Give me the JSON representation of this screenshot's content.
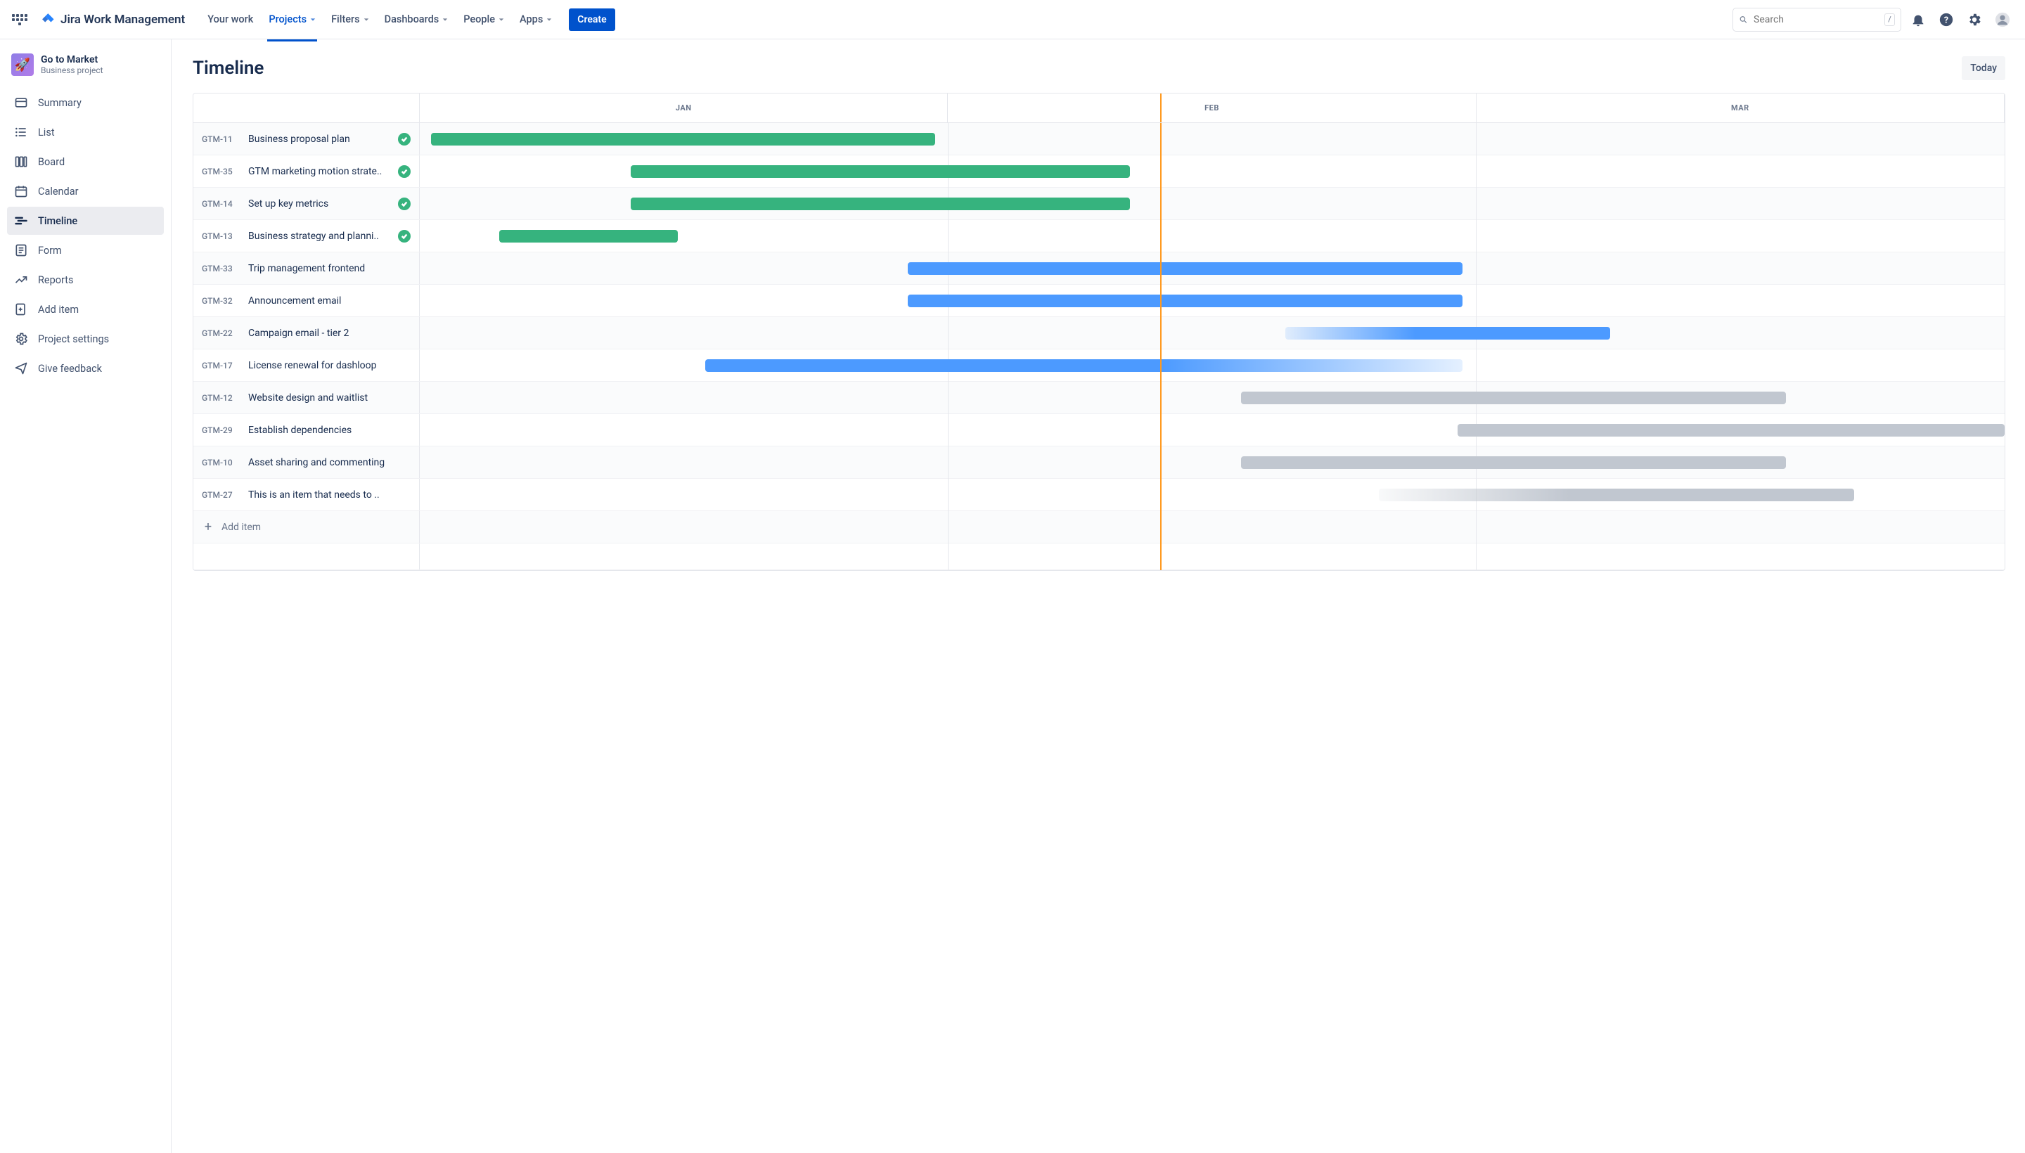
{
  "brand": "Jira Work Management",
  "nav": {
    "your_work": "Your work",
    "projects": "Projects",
    "filters": "Filters",
    "dashboards": "Dashboards",
    "people": "People",
    "apps": "Apps",
    "create": "Create"
  },
  "search": {
    "placeholder": "Search",
    "shortcut": "/"
  },
  "project": {
    "name": "Go to Market",
    "type": "Business project"
  },
  "sidebar": {
    "items": [
      {
        "id": "summary",
        "label": "Summary"
      },
      {
        "id": "list",
        "label": "List"
      },
      {
        "id": "board",
        "label": "Board"
      },
      {
        "id": "calendar",
        "label": "Calendar"
      },
      {
        "id": "timeline",
        "label": "Timeline",
        "active": true
      },
      {
        "id": "form",
        "label": "Form"
      },
      {
        "id": "reports",
        "label": "Reports"
      },
      {
        "id": "add-item",
        "label": "Add item"
      },
      {
        "id": "project-settings",
        "label": "Project settings"
      },
      {
        "id": "give-feedback",
        "label": "Give feedback"
      }
    ]
  },
  "page": {
    "title": "Timeline",
    "today": "Today"
  },
  "timeline": {
    "months": [
      "JAN",
      "FEB",
      "MAR"
    ],
    "today_pct": 46.7,
    "add_item": "Add item",
    "rows": [
      {
        "key": "GTM-11",
        "summary": "Business proposal plan",
        "done": true,
        "bar": {
          "left": 0.7,
          "width": 31.8,
          "style": "green"
        }
      },
      {
        "key": "GTM-35",
        "summary": "GTM marketing motion strate..",
        "done": true,
        "bar": {
          "left": 13.3,
          "width": 31.5,
          "style": "green"
        }
      },
      {
        "key": "GTM-14",
        "summary": "Set up key metrics",
        "done": true,
        "bar": {
          "left": 13.3,
          "width": 31.5,
          "style": "green"
        }
      },
      {
        "key": "GTM-13",
        "summary": "Business strategy and planni..",
        "done": true,
        "bar": {
          "left": 5.0,
          "width": 11.3,
          "style": "green"
        }
      },
      {
        "key": "GTM-33",
        "summary": "Trip management frontend",
        "done": false,
        "bar": {
          "left": 30.8,
          "width": 35.0,
          "style": "blue"
        }
      },
      {
        "key": "GTM-32",
        "summary": "Announcement email",
        "done": false,
        "bar": {
          "left": 30.8,
          "width": 35.0,
          "style": "blue"
        }
      },
      {
        "key": "GTM-22",
        "summary": "Campaign email - tier 2",
        "done": false,
        "bar": {
          "left": 54.6,
          "width": 20.5,
          "style": "fade-left"
        }
      },
      {
        "key": "GTM-17",
        "summary": "License renewal for dashloop",
        "done": false,
        "bar": {
          "left": 18.0,
          "width": 47.8,
          "style": "fade-right"
        }
      },
      {
        "key": "GTM-12",
        "summary": "Website design and waitlist",
        "done": false,
        "bar": {
          "left": 51.8,
          "width": 34.4,
          "style": "grey"
        }
      },
      {
        "key": "GTM-29",
        "summary": "Establish dependencies",
        "done": false,
        "bar": {
          "left": 65.5,
          "width": 34.5,
          "style": "grey"
        }
      },
      {
        "key": "GTM-10",
        "summary": "Asset sharing and commenting",
        "done": false,
        "bar": {
          "left": 51.8,
          "width": 34.4,
          "style": "grey"
        }
      },
      {
        "key": "GTM-27",
        "summary": "This is an item that needs to ..",
        "done": false,
        "bar": {
          "left": 60.5,
          "width": 30.0,
          "style": "fade-grey-left"
        }
      }
    ]
  }
}
